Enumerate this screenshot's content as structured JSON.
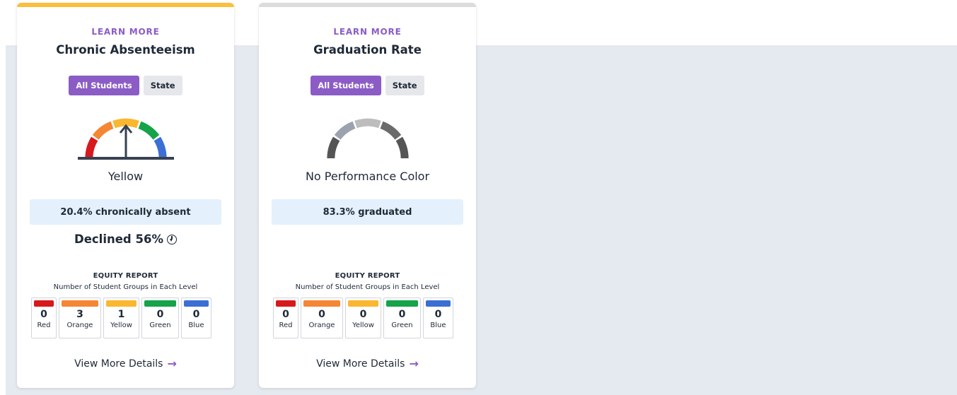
{
  "colors": {
    "accent": "#8b5cc6",
    "red": "#d7191c",
    "orange": "#f58634",
    "yellow": "#fbb72f",
    "green": "#16a34a",
    "blue": "#3b6fd4",
    "grey_light": "#a3a3a3",
    "grey_dark": "#555555"
  },
  "cards": [
    {
      "learn_more": "LEARN MORE",
      "title": "Chronic Absenteeism",
      "toggle_all": "All Students",
      "toggle_state": "State",
      "gauge_icon": "performance-gauge-yellow",
      "performance_color": "Yellow",
      "stat": "20.4% chronically absent",
      "change": "Declined 56%",
      "change_icon": "down-circle-icon",
      "equity_title": "EQUITY REPORT",
      "equity_subtitle": "Number of Student Groups in Each Level",
      "levels": [
        {
          "count": "0",
          "label": "Red"
        },
        {
          "count": "3",
          "label": "Orange"
        },
        {
          "count": "1",
          "label": "Yellow"
        },
        {
          "count": "0",
          "label": "Green"
        },
        {
          "count": "0",
          "label": "Blue"
        }
      ],
      "view_more": "View More Details",
      "arrow": "→"
    },
    {
      "learn_more": "LEARN MORE",
      "title": "Graduation Rate",
      "toggle_all": "All Students",
      "toggle_state": "State",
      "gauge_icon": "performance-gauge-none",
      "performance_color": "No Performance Color",
      "stat": "83.3% graduated",
      "change": "",
      "equity_title": "EQUITY REPORT",
      "equity_subtitle": "Number of Student Groups in Each Level",
      "levels": [
        {
          "count": "0",
          "label": "Red"
        },
        {
          "count": "0",
          "label": "Orange"
        },
        {
          "count": "0",
          "label": "Yellow"
        },
        {
          "count": "0",
          "label": "Green"
        },
        {
          "count": "0",
          "label": "Blue"
        }
      ],
      "view_more": "View More Details",
      "arrow": "→"
    }
  ]
}
